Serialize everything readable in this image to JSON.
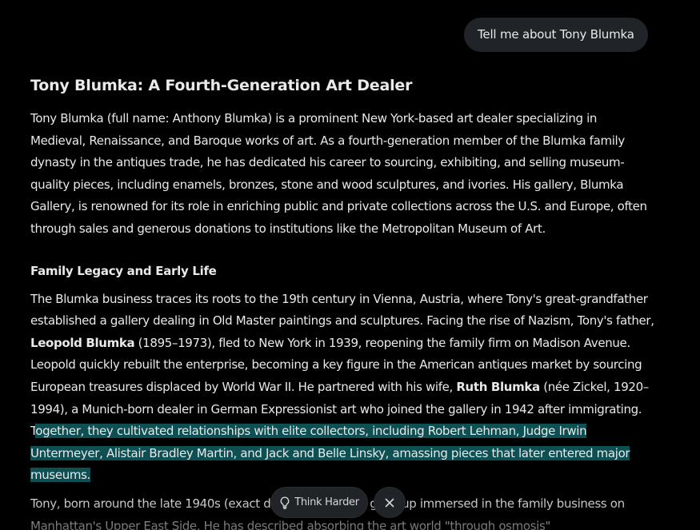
{
  "user_message": "Tell me about Tony Blumka",
  "response": {
    "title": "Tony Blumka: A Fourth-Generation Art Dealer",
    "intro": "Tony Blumka (full name: Anthony Blumka) is a prominent New York-based art dealer specializing in Medieval, Renaissance, and Baroque works of art. As a fourth-generation member of the Blumka family dynasty in the antiques trade, he has dedicated his career to sourcing, exhibiting, and selling museum-quality pieces, including enamels, bronzes, stone and wood sculptures, and ivories. His gallery, Blumka Gallery, is renowned for its role in enriching public and private collections across the U.S. and Europe, often through sales and generous donations to institutions like the Metropolitan Museum of Art.",
    "section_heading": "Family Legacy and Early Life",
    "legacy": {
      "part1": "The Blumka business traces its roots to the 19th century in Vienna, Austria, where Tony's great-grandfather established a gallery dealing in Old Master paintings and sculptures. Facing the rise of Nazism, Tony's father, ",
      "bold1": "Leopold Blumka",
      "part2": " (1895–1973), fled to New York in 1939, reopening the family firm on Madison Avenue. Leopold quickly rebuilt the enterprise, becoming a key figure in the American antiques market by sourcing European treasures displaced by World War II. He partnered with his wife, ",
      "bold2": "Ruth Blumka",
      "part3": " (née Zickel, 1920–1994), a Munich-born dealer in German Expressionist art who joined the gallery in 1942 after immigrating. T",
      "highlighted": "ogether, they cultivated relationships with elite collectors, including Robert Lehman, Judge Irwin Untermeyer, Alistair Bradley Martin, and Jack and Belle Linsky, amassing pieces that later entered major museums."
    },
    "next_paragraph": "Tony, born around the late 1940s (exact date not verified), grew up immersed in the family business on Manhattan's Upper East Side. He has described absorbing the art world \"through osmosis\""
  },
  "actions": {
    "think_harder_label": "Think Harder",
    "think_harder_icon": "lightbulb-icon",
    "close_icon": "close-icon"
  },
  "colors": {
    "background": "#000000",
    "text": "#e7e9ea",
    "bubble": "#202327",
    "highlight": "#0d4f52"
  }
}
